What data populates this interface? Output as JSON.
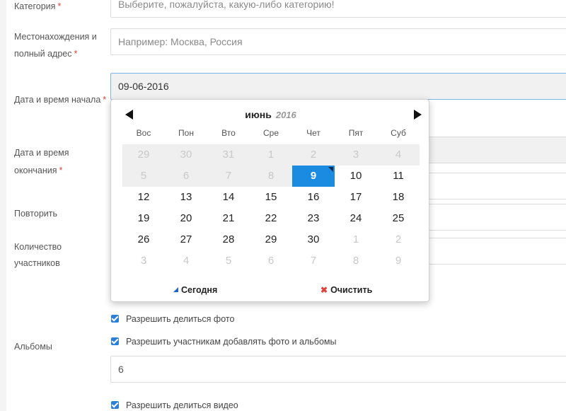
{
  "form": {
    "category": {
      "label": "Категория",
      "placeholder": "Выберите, пожалуйста, какую-либо категорию!"
    },
    "location": {
      "label_line1": "Местонахождения и",
      "label_line2": "полный адрес",
      "placeholder": "Например: Москва, Россия"
    },
    "start": {
      "label": "Дата и время начала",
      "value": "09-06-2016"
    },
    "end": {
      "label_line1": "Дата и время",
      "label_line2": "окончания"
    },
    "repeat": {
      "label": "Повторить"
    },
    "participants": {
      "label_line1": "Количество",
      "label_line2": "участников"
    },
    "albums": {
      "label": "Альбомы",
      "value": "6"
    },
    "checkboxes": {
      "share_photo": "Разрешить делиться фото",
      "add_albums": "Разрешить участникам добавлять фото и альбомы",
      "share_video": "Разрешить делиться видео"
    },
    "required_mark": "*"
  },
  "datepicker": {
    "month": "июнь",
    "year": "2016",
    "weekdays": [
      "Вос",
      "Пон",
      "Вто",
      "Сре",
      "Чет",
      "Пят",
      "Суб"
    ],
    "weeks": [
      [
        "29",
        "30",
        "31",
        "1",
        "2",
        "3",
        "4"
      ],
      [
        "5",
        "6",
        "7",
        "8",
        "9",
        "10",
        "11"
      ],
      [
        "12",
        "13",
        "14",
        "15",
        "16",
        "17",
        "18"
      ],
      [
        "19",
        "20",
        "21",
        "22",
        "23",
        "24",
        "25"
      ],
      [
        "26",
        "27",
        "28",
        "29",
        "30",
        "1",
        "2"
      ],
      [
        "3",
        "4",
        "5",
        "6",
        "7",
        "8",
        "9"
      ]
    ],
    "selected_day": "9",
    "today_label": "Сегодня",
    "clear_label": "Очистить"
  },
  "colors": {
    "accent": "#1a8be0",
    "required": "#e0413b",
    "checkbox": "#2b7fd8"
  }
}
